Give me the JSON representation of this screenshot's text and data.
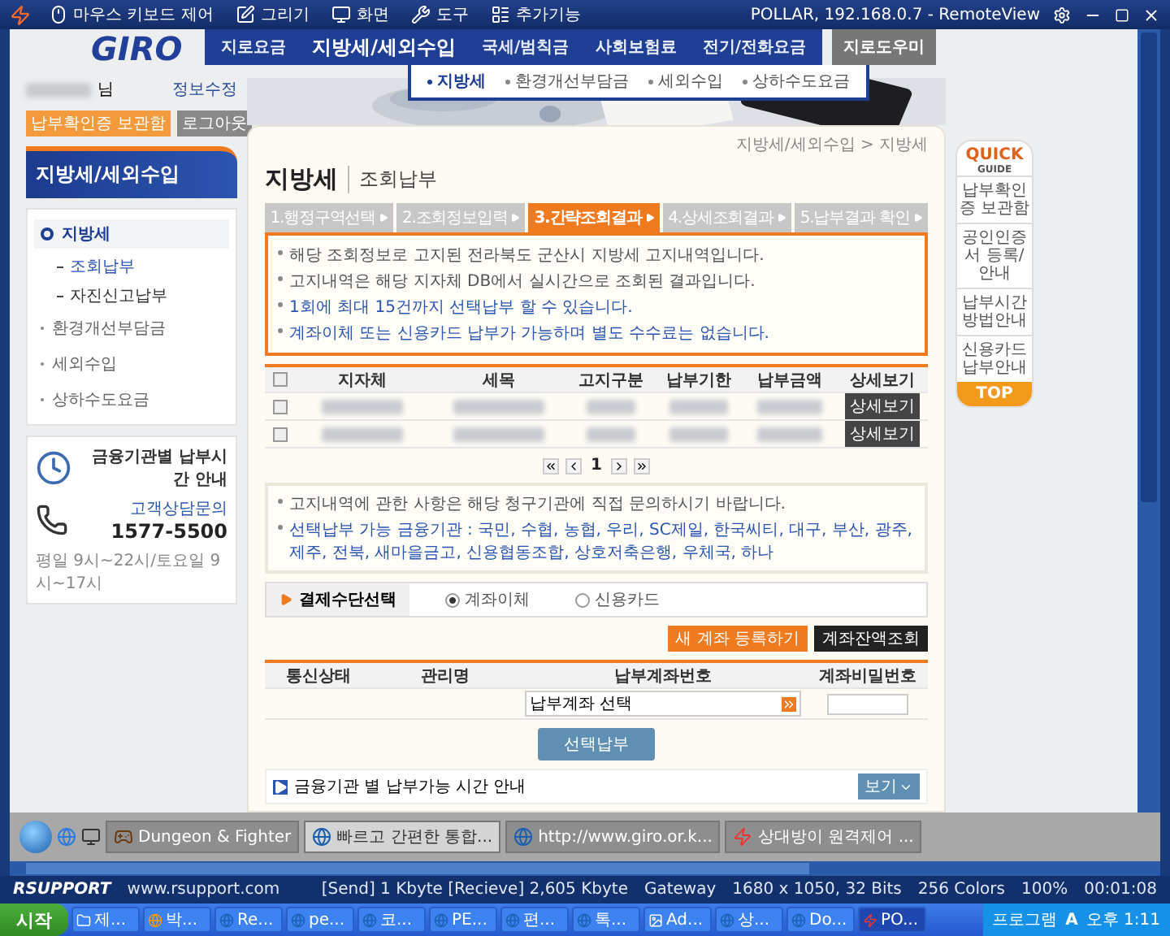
{
  "remote_toolbar": {
    "items": [
      {
        "label": "마우스 키보드 제어",
        "kind": "mouse"
      },
      {
        "label": "그리기",
        "kind": "draw"
      },
      {
        "label": "화면",
        "kind": "screen"
      },
      {
        "label": "도구",
        "kind": "tools"
      },
      {
        "label": "추가기능",
        "kind": "extra"
      }
    ],
    "title": "POLLAR, 192.168.0.7 - RemoteView"
  },
  "site": {
    "logo": "GIRO",
    "nav": [
      {
        "label": "지로요금",
        "selected": false
      },
      {
        "label": "지방세/세외수입",
        "selected": true
      },
      {
        "label": "국세/범칙금",
        "selected": false
      },
      {
        "label": "사회보험료",
        "selected": false
      },
      {
        "label": "전기/전화요금",
        "selected": false
      }
    ],
    "helper_button": "지로도우미",
    "submenu": [
      {
        "label": "지방세",
        "selected": true
      },
      {
        "label": "환경개선부담금",
        "selected": false
      },
      {
        "label": "세외수입",
        "selected": false
      },
      {
        "label": "상하수도요금",
        "selected": false
      }
    ],
    "user": {
      "suffix": "님",
      "edit": "정보수정",
      "receipts": "납부확인증 보관함",
      "logout": "로그아웃"
    },
    "sidebar": {
      "title": "지방세/세외수입",
      "items": [
        {
          "label": "지방세",
          "selected": true,
          "children": [
            {
              "label": "조회납부",
              "selected": true
            },
            {
              "label": "자진신고납부",
              "selected": false
            }
          ]
        },
        {
          "label": "환경개선부담금",
          "selected": false
        },
        {
          "label": "세외수입",
          "selected": false
        },
        {
          "label": "상하수도요금",
          "selected": false
        }
      ]
    },
    "info_card": {
      "title": "금융기관별 납부시간 안내"
    },
    "contact": {
      "label": "고객상담문의",
      "phone": "1577-5500",
      "hours": "평일 9시~22시/토요일 9시~17시"
    },
    "main": {
      "breadcrumb": "지방세/세외수입 > 지방세",
      "title": "지방세",
      "subtitle": "조회납부",
      "steps": [
        {
          "label": "1.행정구역선택",
          "selected": false
        },
        {
          "label": "2.조회정보입력",
          "selected": false
        },
        {
          "label": "3.간략조회결과",
          "selected": true
        },
        {
          "label": "4.상세조회결과",
          "selected": false
        },
        {
          "label": "5.납부결과 확인",
          "selected": false
        }
      ],
      "notices": [
        {
          "text": "해당 조회정보로 고지된 전라북도 군산시 지방세 고지내역입니다.",
          "highlight": false
        },
        {
          "text": "고지내역은 해당 지자체 DB에서 실시간으로 조회된 결과입니다.",
          "highlight": false
        },
        {
          "text": "1회에 최대 15건까지 선택납부 할 수 있습니다.",
          "highlight": true
        },
        {
          "text": "계좌이체 또는 신용카드 납부가 가능하며 별도 수수료는 없습니다.",
          "highlight": true
        }
      ],
      "table": {
        "select_all": false,
        "columns": [
          "지자체",
          "세목",
          "고지구분",
          "납부기한",
          "납부금액",
          "상세보기"
        ],
        "rows": [
          {
            "checked": false,
            "button": "상세보기"
          },
          {
            "checked": false,
            "button": "상세보기"
          }
        ]
      },
      "pages": [
        {
          "label": "1",
          "selected": true
        }
      ],
      "notes": [
        {
          "text": "고지내역에 관한 사항은 해당 청구기관에 직접 문의하시기 바랍니다.",
          "highlight": false
        },
        {
          "text": "선택납부 가능 금융기관 : 국민, 수협, 농협, 우리, SC제일, 한국씨티, 대구, 부산, 광주, 제주, 전북, 새마을금고, 신용협동조합, 상호저축은행, 우체국, 하나",
          "highlight": true
        }
      ],
      "payment": {
        "label": "결제수단선택",
        "options": [
          {
            "label": "계좌이체",
            "selected": true
          },
          {
            "label": "신용카드",
            "selected": false
          }
        ]
      },
      "account_buttons": [
        {
          "label": "새 계좌 등록하기",
          "kind": "primary"
        },
        {
          "label": "계좌잔액조회",
          "kind": "dark"
        }
      ],
      "account_table": {
        "columns": [
          "통신상태",
          "관리명",
          "납부계좌번호",
          "계좌비밀번호"
        ],
        "account_select": "납부계좌 선택"
      },
      "submit": "선택납부",
      "footer": {
        "text": "금융기관 별 납부가능 시간 안내",
        "button": "보기"
      }
    },
    "quick_guide": {
      "title": "QUICK",
      "subtitle": "GUIDE",
      "items": [
        "납부확인증 보관함",
        "공인인증서 등록/안내",
        "납부시간 방법안내",
        "신용카드 납부안내"
      ],
      "top": "TOP"
    }
  },
  "remote_taskbar": {
    "tasks": [
      {
        "label": "Dungeon & Fighter",
        "kind": "game",
        "selected": false
      },
      {
        "label": "빠르고 간편한 통합...",
        "kind": "browser",
        "selected": true
      },
      {
        "label": "http://www.giro.or.k...",
        "kind": "browser",
        "selected": false
      },
      {
        "label": "상대방이 원격제어 ...",
        "kind": "remote",
        "selected": false
      }
    ]
  },
  "status_bar": {
    "brand": "RSUPPORT",
    "url": "www.rsupport.com",
    "transfer": "[Send] 1 Kbyte  [Recieve] 2,605 Kbyte",
    "gateway": "Gateway",
    "resolution": "1680 x 1050, 32 Bits",
    "colors": "256 Colors",
    "zoom": "100%",
    "elapsed": "00:01:08"
  },
  "taskbar": {
    "start": "시작",
    "tasks": [
      {
        "label": "제...",
        "kind": "folder",
        "selected": false
      },
      {
        "label": "박...",
        "kind": "app",
        "selected": false
      },
      {
        "label": "Re...",
        "kind": "browser",
        "selected": false
      },
      {
        "label": "pe...",
        "kind": "browser",
        "selected": false
      },
      {
        "label": "코...",
        "kind": "browser",
        "selected": false
      },
      {
        "label": "PE...",
        "kind": "browser",
        "selected": false
      },
      {
        "label": "편...",
        "kind": "browser",
        "selected": false
      },
      {
        "label": "톡...",
        "kind": "browser",
        "selected": false
      },
      {
        "label": "Ad...",
        "kind": "ps",
        "selected": false
      },
      {
        "label": "상...",
        "kind": "browser",
        "selected": false
      },
      {
        "label": "Do...",
        "kind": "browser",
        "selected": false
      },
      {
        "label": "PO...",
        "kind": "remote",
        "selected": true
      }
    ],
    "programs": "프로그램",
    "ime": "A",
    "clock": "오후 1:11"
  }
}
